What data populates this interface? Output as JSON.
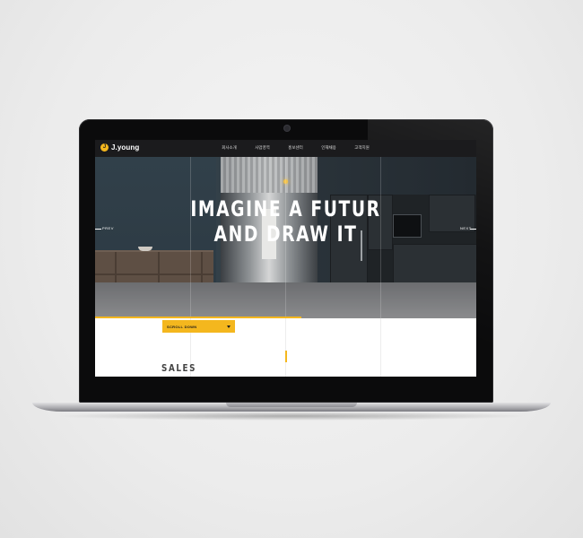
{
  "site": {
    "logo_text": "J.young",
    "logo_mark": "J",
    "menu": [
      "회사소개",
      "사업영역",
      "홍보센터",
      "인재채용",
      "고객지원"
    ]
  },
  "hero": {
    "title_line1": "IMAGINE A FUTUR",
    "title_line2": "AND DRAW IT",
    "prev_label": "PREV",
    "next_label": "NEXT"
  },
  "scroll": {
    "label": "SCROLL DOWN",
    "icon": "chevron-down-icon"
  },
  "section": {
    "heading": "SALES"
  },
  "colors": {
    "accent": "#f4b71e",
    "nav_bg": "#1b1b1d"
  }
}
